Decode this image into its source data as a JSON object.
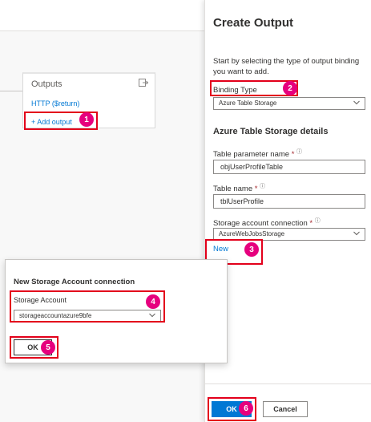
{
  "canvas": {
    "outputs": {
      "title": "Outputs",
      "http_item": "HTTP ($return)",
      "add_output": "+ Add output"
    }
  },
  "panel": {
    "title": "Create Output",
    "description": "Start by selecting the type of output binding you want to add.",
    "binding_type_label": "Binding Type",
    "binding_type_value": "Azure Table Storage",
    "section_title": "Azure Table Storage details",
    "table_param_label": "Table parameter name",
    "table_param_value": "objUserProfileTable",
    "table_name_label": "Table name",
    "table_name_value": "tblUserProfile",
    "storage_conn_label": "Storage account connection",
    "storage_conn_value": "AzureWebJobsStorage",
    "new_link": "New",
    "ok_label": "OK",
    "cancel_label": "Cancel",
    "required_mark": "*",
    "info_mark": "ⓘ"
  },
  "dialog": {
    "title": "New Storage Account connection",
    "storage_label": "Storage Account",
    "storage_value": "storageaccountazure9bfe",
    "ok_label": "OK"
  },
  "badges": [
    "1",
    "2",
    "3",
    "4",
    "5",
    "6"
  ],
  "colors": {
    "accent": "#0078d4",
    "highlight_box": "#e3001b",
    "badge": "#e6007e"
  }
}
